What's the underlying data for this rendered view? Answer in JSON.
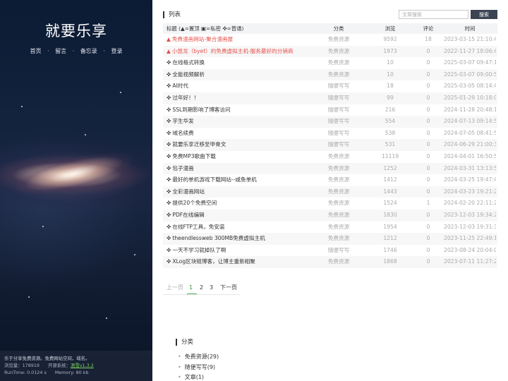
{
  "sidebar": {
    "site_title": "就要乐享",
    "nav": [
      "首页",
      "留言",
      "备忘录",
      "登录"
    ],
    "nav_separator": "·",
    "footer": {
      "description": "乐于分享免费资源。免费网站空间，域名。",
      "views_label": "浏览量：",
      "views_value": "178919",
      "system_label": "开源系统：",
      "system_value": "测雪v1.3.2",
      "runtime": "RunTime: 0.0124 s",
      "memory": "Memory: 80 kb"
    }
  },
  "list": {
    "title": "列表",
    "search_placeholder": "文章搜索",
    "search_button": "搜索",
    "headers": {
      "title": "标题 (▲=置顶 ▣=私密 ✜=普通)",
      "category": "分类",
      "views": "浏览",
      "comments": "评论",
      "time": "时间"
    },
    "rows": [
      {
        "mark": "▲",
        "title": "免费漫画网站-聚合漫画屋",
        "category": "免费资源",
        "views": "9592",
        "comments": "18",
        "time": "2023-03-15 21:10:42",
        "pinned": true
      },
      {
        "mark": "▲",
        "title": "小悠龙（byet）的免费虚拟主机-服务最好的分销商",
        "category": "免费资源",
        "views": "1973",
        "comments": "0",
        "time": "2022-11-27 18:06:46",
        "pinned": true
      },
      {
        "mark": "✜",
        "title": "在线格式转换",
        "category": "免费资源",
        "views": "10",
        "comments": "0",
        "time": "2025-03-07 09:47:15",
        "pinned": false
      },
      {
        "mark": "✜",
        "title": "全能视频解析",
        "category": "免费资源",
        "views": "10",
        "comments": "0",
        "time": "2025-03-07 09:00:59",
        "pinned": false
      },
      {
        "mark": "✜",
        "title": "AI时代",
        "category": "随便写写",
        "views": "18",
        "comments": "0",
        "time": "2025-03-05 08:14:40",
        "pinned": false
      },
      {
        "mark": "✜",
        "title": "过年好！！",
        "category": "随便写写",
        "views": "99",
        "comments": "0",
        "time": "2025-01-29 10:18:05",
        "pinned": false
      },
      {
        "mark": "✜",
        "title": "SSL到期影响了博客访问",
        "category": "随便写写",
        "views": "216",
        "comments": "0",
        "time": "2024-11-28 20:48:12",
        "pinned": false
      },
      {
        "mark": "✜",
        "title": "芋生华发",
        "category": "随便写写",
        "views": "554",
        "comments": "0",
        "time": "2024-07-13 09:14:55",
        "pinned": false
      },
      {
        "mark": "✜",
        "title": "域名续费",
        "category": "随便写写",
        "views": "538",
        "comments": "0",
        "time": "2024-07-05 08:41:58",
        "pinned": false
      },
      {
        "mark": "✜",
        "title": "就要乐享迁移至甲骨文",
        "category": "随便写写",
        "views": "531",
        "comments": "0",
        "time": "2024-06-29 21:00:37",
        "pinned": false
      },
      {
        "mark": "✜",
        "title": "免费MP3歌曲下载",
        "category": "免费资源",
        "views": "11119",
        "comments": "0",
        "time": "2024-04-01 16:50:55",
        "pinned": false
      },
      {
        "mark": "✜",
        "title": "包子漫画",
        "category": "免费资源",
        "views": "1252",
        "comments": "0",
        "time": "2024-03-31 13:13:59",
        "pinned": false
      },
      {
        "mark": "✜",
        "title": "最好的单机游戏下载网站--咸鱼单机",
        "category": "免费资源",
        "views": "1412",
        "comments": "0",
        "time": "2024-03-25 19:47:41",
        "pinned": false
      },
      {
        "mark": "✜",
        "title": "全彩漫画网站",
        "category": "免费资源",
        "views": "1443",
        "comments": "0",
        "time": "2024-03-23 19:21:27",
        "pinned": false
      },
      {
        "mark": "✜",
        "title": "提供20个免费空间",
        "category": "免费资源",
        "views": "1524",
        "comments": "1",
        "time": "2024-02-20 22:11:28",
        "pinned": false
      },
      {
        "mark": "✜",
        "title": "PDF在线编辑",
        "category": "免费资源",
        "views": "1830",
        "comments": "0",
        "time": "2023-12-03 19:34:21",
        "pinned": false
      },
      {
        "mark": "✜",
        "title": "在线FTP工具，免安装",
        "category": "免费资源",
        "views": "1954",
        "comments": "0",
        "time": "2023-12-03 19:31:38",
        "pinned": false
      },
      {
        "mark": "✜",
        "title": "theendlessweb 300MB免费虚拟主机",
        "category": "免费资源",
        "views": "1212",
        "comments": "0",
        "time": "2023-11-25 22:49:14",
        "pinned": false
      },
      {
        "mark": "✜",
        "title": "一天不学习就掉队了啊",
        "category": "随便写写",
        "views": "1746",
        "comments": "0",
        "time": "2023-08-24 20:04:05",
        "pinned": false
      },
      {
        "mark": "✜",
        "title": "XLog区块链博客，让博主重新相聚",
        "category": "免费资源",
        "views": "1868",
        "comments": "0",
        "time": "2023-07-11 11:27:22",
        "pinned": false
      }
    ]
  },
  "pager": {
    "prev": "上一页",
    "pages": [
      "1",
      "2",
      "3"
    ],
    "current": "1",
    "next": "下一页"
  },
  "categories": {
    "title": "分类",
    "bullet": "•",
    "items": [
      "免费资源(29)",
      "随便写写(9)",
      "文章(1)"
    ]
  },
  "colors": {
    "pinned": "#e5504a",
    "active_page": "#4caf50",
    "search_button_bg": "#3c4352"
  }
}
